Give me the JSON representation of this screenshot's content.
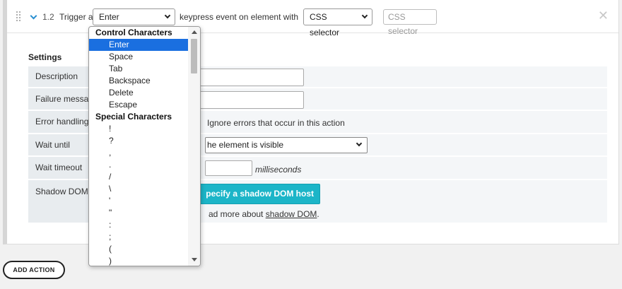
{
  "step": {
    "number": "1.2",
    "text_before": "Trigger a",
    "key_select": "Enter",
    "text_middle": "keypress event on element with",
    "selector_type": "CSS selector",
    "selector_placeholder": "CSS selector",
    "close_glyph": "✕"
  },
  "settings": {
    "title": "Settings",
    "rows": {
      "description": "Description",
      "failure_message": "Failure messag",
      "error_handling": "Error handling",
      "wait_until": "Wait until",
      "wait_timeout": "Wait timeout",
      "shadow_dom": "Shadow DOM"
    },
    "ignore_errors_label": "Ignore errors that occur in this action",
    "wait_until_value": "he element is visible",
    "milliseconds_label": "milliseconds",
    "shadow_button_label": "pecify a shadow DOM host",
    "read_more_prefix": "ad more about ",
    "read_more_link": "shadow DOM",
    "read_more_suffix": "."
  },
  "add_action_label": "ADD ACTION",
  "dropdown": {
    "groups": [
      {
        "label": "Control Characters",
        "items": [
          "Enter",
          "Space",
          "Tab",
          "Backspace",
          "Delete",
          "Escape"
        ]
      },
      {
        "label": "Special Characters",
        "items": [
          "!",
          "?",
          ",",
          ".",
          "/",
          "\\",
          "'",
          "\"",
          ":",
          ";",
          "(",
          ")"
        ]
      }
    ],
    "selected": "Enter"
  },
  "colors": {
    "accent": "#2a8fd1",
    "selected_bg": "#1a6fe0",
    "shadow_button": "#1cb5c8"
  }
}
